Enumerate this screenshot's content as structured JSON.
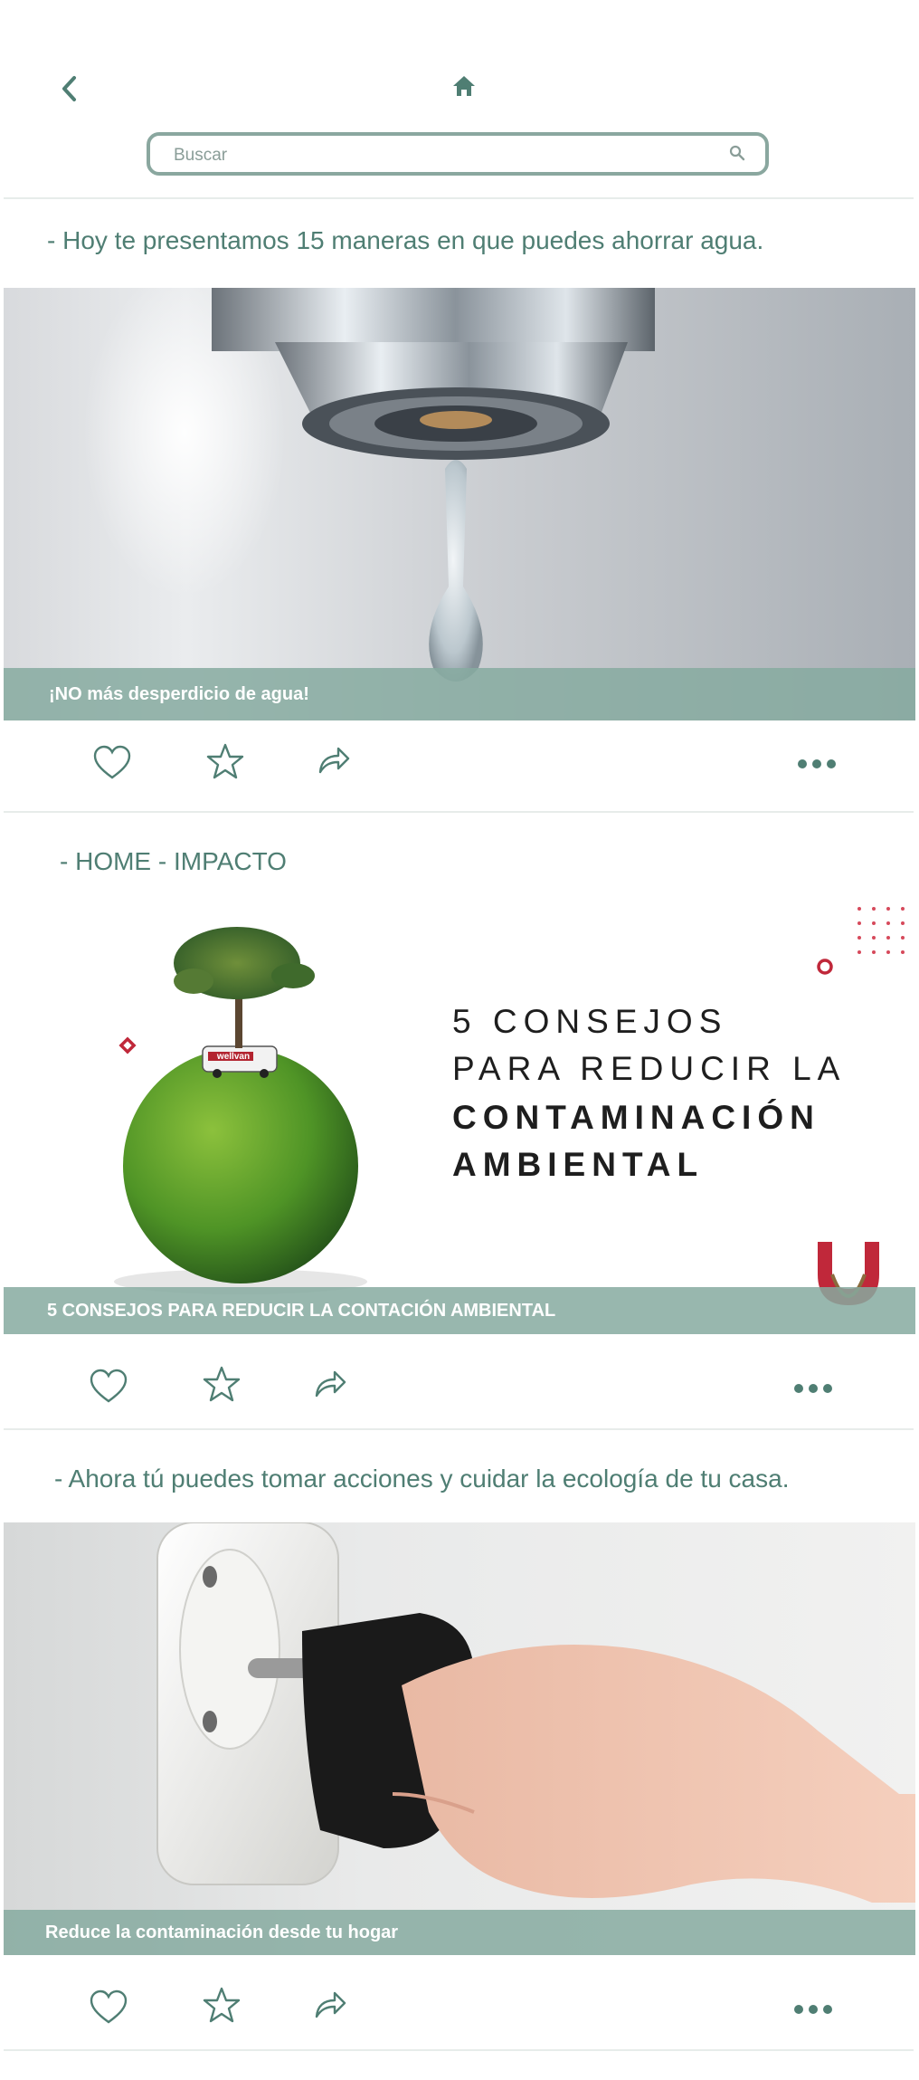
{
  "header": {
    "back_icon": "chevron-left-icon",
    "home_icon": "home-icon",
    "search": {
      "placeholder": "Buscar",
      "icon": "search-icon"
    }
  },
  "posts": [
    {
      "text": "- Hoy te presentamos 15 maneras en que puedes ahorrar agua.",
      "caption": "¡NO más desperdicio de agua!",
      "actions": [
        "heart-icon",
        "star-icon",
        "share-icon",
        "more-icon"
      ]
    },
    {
      "text": "- HOME - IMPACTO",
      "card_title": [
        "5 CONSEJOS",
        "PARA REDUCIR LA",
        "CONTAMINACIÓN",
        "AMBIENTAL"
      ],
      "van_label": "wellvan",
      "caption": "5 CONSEJOS PARA REDUCIR LA CONTACIÓN AMBIENTAL",
      "actions": [
        "heart-icon",
        "star-icon",
        "share-icon",
        "more-icon"
      ]
    },
    {
      "text": "- Ahora tú puedes tomar acciones y cuidar la ecología de tu casa.",
      "caption": "Reduce la contaminación desde tu hogar",
      "actions": [
        "heart-icon",
        "star-icon",
        "share-icon",
        "more-icon"
      ]
    }
  ],
  "colors": {
    "primary": "#4f7e73",
    "caption_bar": "#86aaa0",
    "search_border": "#8aa79f",
    "accent_red": "#c0283a"
  }
}
